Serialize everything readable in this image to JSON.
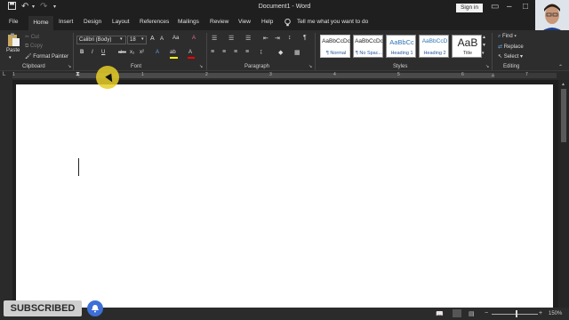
{
  "title_bar": {
    "document_title": "Document1 - Word",
    "sign_in_label": "Sign in",
    "quick_access": [
      "save-icon",
      "undo-icon",
      "redo-icon",
      "customize-icon"
    ]
  },
  "tabs": [
    "File",
    "Home",
    "Insert",
    "Design",
    "Layout",
    "References",
    "Mailings",
    "Review",
    "View",
    "Help"
  ],
  "tell_me": "Tell me what you want to do",
  "ribbon": {
    "clipboard": {
      "label": "Clipboard",
      "paste": "Paste",
      "cut": "Cut",
      "copy": "Copy",
      "format_painter": "Format Painter"
    },
    "font": {
      "label": "Font",
      "font_name": "Calibri (Body)",
      "font_size": "18",
      "bold": "B",
      "italic": "I",
      "underline": "U",
      "strike": "abc",
      "subscript": "x₂",
      "superscript": "x²",
      "grow": "A",
      "shrink": "A",
      "case": "Aa",
      "clear": "A",
      "effects": "A",
      "highlight": "ab",
      "color": "A"
    },
    "paragraph": {
      "label": "Paragraph"
    },
    "styles": {
      "label": "Styles",
      "items": [
        {
          "sample": "AaBbCcDc",
          "name": "¶ Normal"
        },
        {
          "sample": "AaBbCcDc",
          "name": "¶ No Spac..."
        },
        {
          "sample": "AaBbCc",
          "name": "Heading 1"
        },
        {
          "sample": "AaBbCcD",
          "name": "Heading 2"
        },
        {
          "sample": "AaB",
          "name": "Title"
        }
      ]
    },
    "editing": {
      "label": "Editing",
      "find": "Find",
      "replace": "Replace",
      "select": "Select"
    }
  },
  "ruler": {
    "numbers": [
      "1",
      "1",
      "2",
      "3",
      "4",
      "5",
      "6",
      "7"
    ]
  },
  "status_bar": {
    "zoom": "150%"
  },
  "overlay": {
    "subscribed": "SUBSCRIBED"
  },
  "colors": {
    "accent": "#2b579a",
    "highlight": "#ffff00",
    "font_color": "#ff0000",
    "pointer": "#e6cd28"
  }
}
